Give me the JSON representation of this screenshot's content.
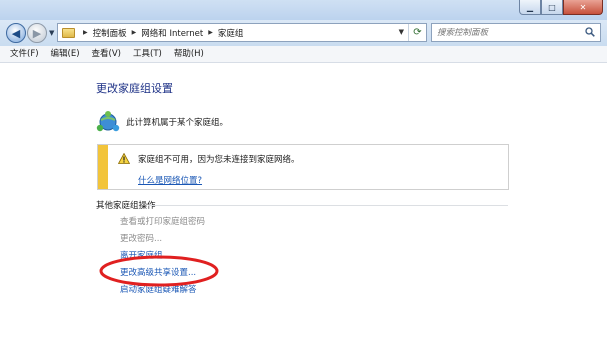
{
  "window": {
    "minimize_glyph": "▁",
    "maximize_glyph": "□",
    "close_glyph": "✕"
  },
  "address": {
    "breadcrumb": [
      "控制面板",
      "网络和 Internet",
      "家庭组"
    ],
    "search_placeholder": "搜索控制面板"
  },
  "menu": [
    "文件(F)",
    "编辑(E)",
    "查看(V)",
    "工具(T)",
    "帮助(H)"
  ],
  "content": {
    "title": "更改家庭组设置",
    "status": "此计算机属于某个家庭组。",
    "warning": {
      "text": "家庭组不可用，因为您未连接到家庭网络。",
      "link": "什么是网络位置?"
    },
    "section_title": "其他家庭组操作",
    "tasks": [
      {
        "label": "查看或打印家庭组密码",
        "enabled": false
      },
      {
        "label": "更改密码...",
        "enabled": false
      },
      {
        "label": "离开家庭组...",
        "enabled": true
      },
      {
        "label": "更改高级共享设置...",
        "enabled": true
      },
      {
        "label": "启动家庭组疑难解答",
        "enabled": true
      }
    ]
  },
  "icons": {
    "back": "back-arrow-icon",
    "forward": "forward-arrow-icon",
    "folder": "control-panel-folder-icon",
    "refresh": "refresh-icon",
    "search": "search-icon",
    "homegroup": "homegroup-icon",
    "warning": "warning-icon"
  },
  "colors": {
    "link": "#1a57b5",
    "title": "#1e3287",
    "warning_bar": "#f2c43a",
    "annotation_ellipse": "#e02020"
  }
}
